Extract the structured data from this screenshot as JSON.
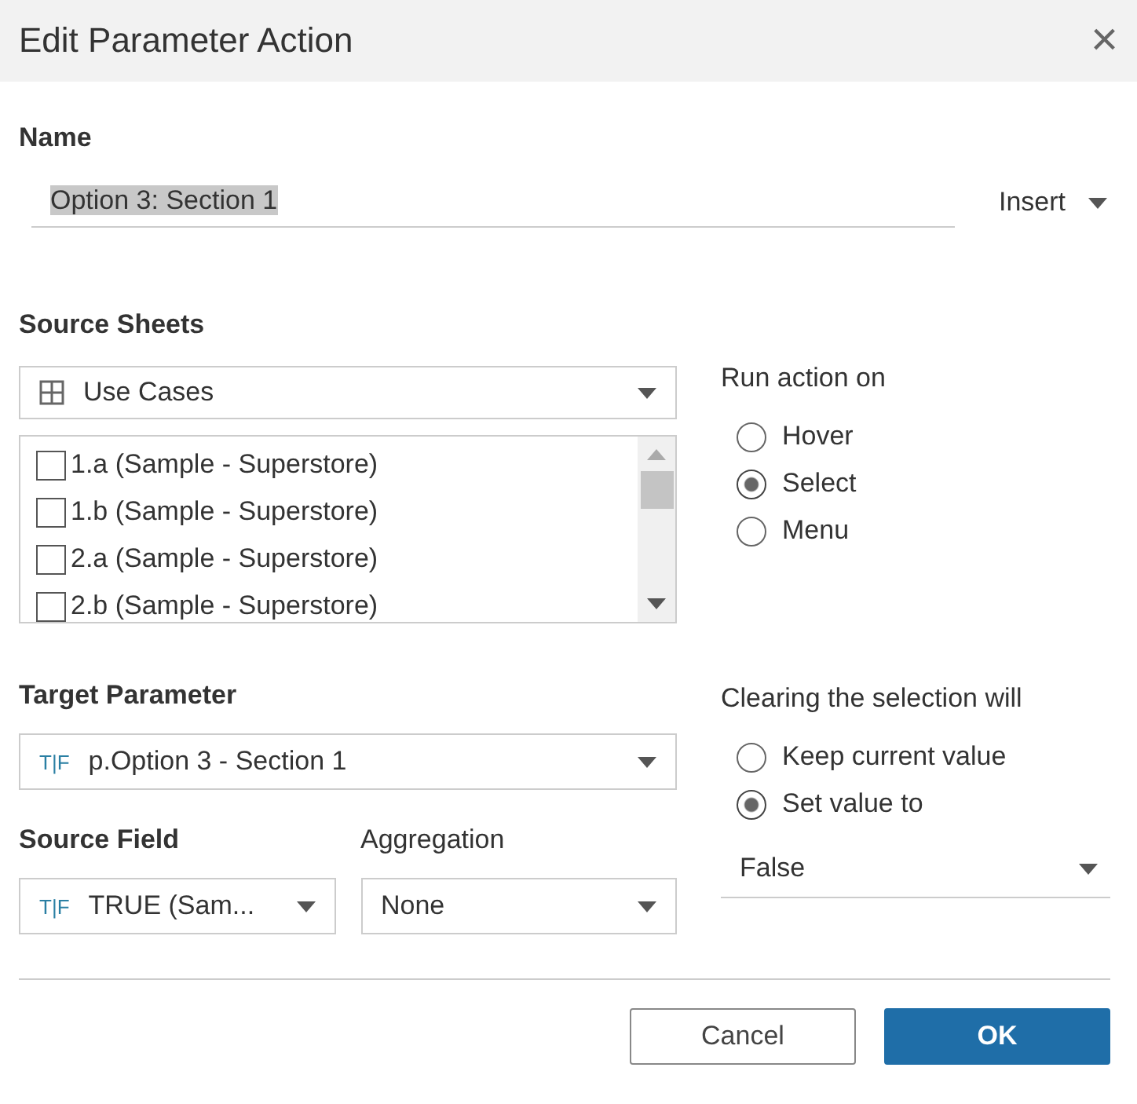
{
  "window": {
    "title": "Edit Parameter Action",
    "close": "×"
  },
  "name": {
    "label": "Name",
    "value": "Option 3: Section 1",
    "text_selected": true,
    "insert": "Insert"
  },
  "source_sheets": {
    "label": "Source Sheets",
    "dropdown": "Use Cases",
    "items": [
      {
        "label": "1.a (Sample - Superstore)",
        "checked": false
      },
      {
        "label": "1.b (Sample - Superstore)",
        "checked": false
      },
      {
        "label": "2.a (Sample - Superstore)",
        "checked": false
      },
      {
        "label": "2.b (Sample - Superstore)",
        "checked": false
      }
    ]
  },
  "run_action_on": {
    "label": "Run action on",
    "options": [
      {
        "label": "Hover",
        "selected": false
      },
      {
        "label": "Select",
        "selected": true
      },
      {
        "label": "Menu",
        "selected": false
      }
    ]
  },
  "target_parameter": {
    "label": "Target Parameter",
    "type_icon": "T|F",
    "value": "p.Option 3 - Section 1"
  },
  "source_field": {
    "label": "Source Field",
    "type_icon": "T|F",
    "value": "TRUE (Sam..."
  },
  "aggregation": {
    "label": "Aggregation",
    "value": "None"
  },
  "clearing": {
    "label": "Clearing the selection will",
    "options": [
      {
        "label": "Keep current value",
        "selected": false
      },
      {
        "label": "Set value to",
        "selected": true
      }
    ],
    "value": "False"
  },
  "buttons": [
    {
      "label": "Cancel",
      "kind": "secondary"
    },
    {
      "label": "OK",
      "kind": "primary"
    }
  ]
}
